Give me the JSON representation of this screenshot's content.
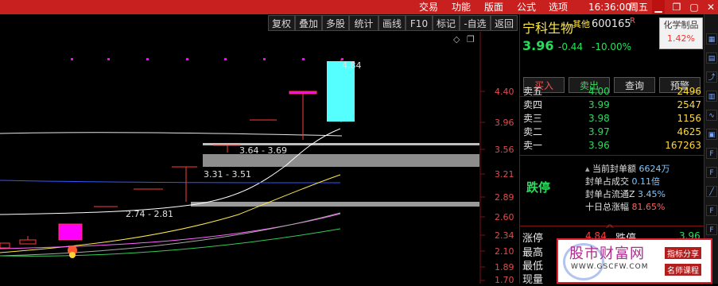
{
  "menu": {
    "items": [
      "交易",
      "功能",
      "版面",
      "公式",
      "选项"
    ],
    "clock": "16:36:00",
    "weekday": "周五"
  },
  "toolbar": {
    "buttons": [
      "复权",
      "叠加",
      "多股",
      "统计",
      "画线",
      "F10",
      "标记",
      "-自选",
      "返回"
    ]
  },
  "chart": {
    "y_ticks": [
      "4.40",
      "3.96",
      "3.56",
      "3.21",
      "2.89",
      "2.60",
      "2.34",
      "2.10",
      "1.89",
      "1.70"
    ],
    "high_label": "4.84",
    "ranges": [
      "3.64 - 3.69",
      "3.31 - 3.51",
      "2.74 - 2.81"
    ],
    "colors": {
      "up": "#ff2c2c",
      "limit_down_box": "#55ffff",
      "magenta": "#ff00ff",
      "grid": "#7a1010"
    }
  },
  "quote": {
    "name": "宁科生物",
    "tag": "其他",
    "code": "600165",
    "code_suffix": "R",
    "sector": "化学制品",
    "sector_pct": "1.42%",
    "price": "3.96",
    "change": "-0.44",
    "change_pct": "-10.00%",
    "buttons": {
      "buy": "买入",
      "sell": "卖出",
      "query": "查询",
      "alert": "预警"
    }
  },
  "order_book": [
    {
      "label": "卖五",
      "price": "4.00",
      "vol": "2496"
    },
    {
      "label": "卖四",
      "price": "3.99",
      "vol": "2547"
    },
    {
      "label": "卖三",
      "price": "3.98",
      "vol": "1156"
    },
    {
      "label": "卖二",
      "price": "3.97",
      "vol": "4625"
    },
    {
      "label": "卖一",
      "price": "3.96",
      "vol": "167263"
    }
  ],
  "limit": {
    "status": "跌停",
    "rows": [
      {
        "label": "当前封单额",
        "value": "6624万"
      },
      {
        "label": "封单占成交",
        "value": "0.11倍"
      },
      {
        "label": "封单占流通Z",
        "value": "3.45%"
      },
      {
        "label": "十日总涨幅",
        "value": "81.65%"
      }
    ]
  },
  "bottom": {
    "rows": [
      {
        "label": "涨停",
        "value": "4.84",
        "label2": "跌停",
        "value2": "3.96"
      },
      {
        "label": "最高"
      },
      {
        "label": "最低"
      },
      {
        "label": "现量"
      }
    ]
  },
  "ad": {
    "title": "股市财富网",
    "tag1": "指标分享",
    "url": "WWW.GSCFW.COM",
    "tag2": "名师课程"
  }
}
